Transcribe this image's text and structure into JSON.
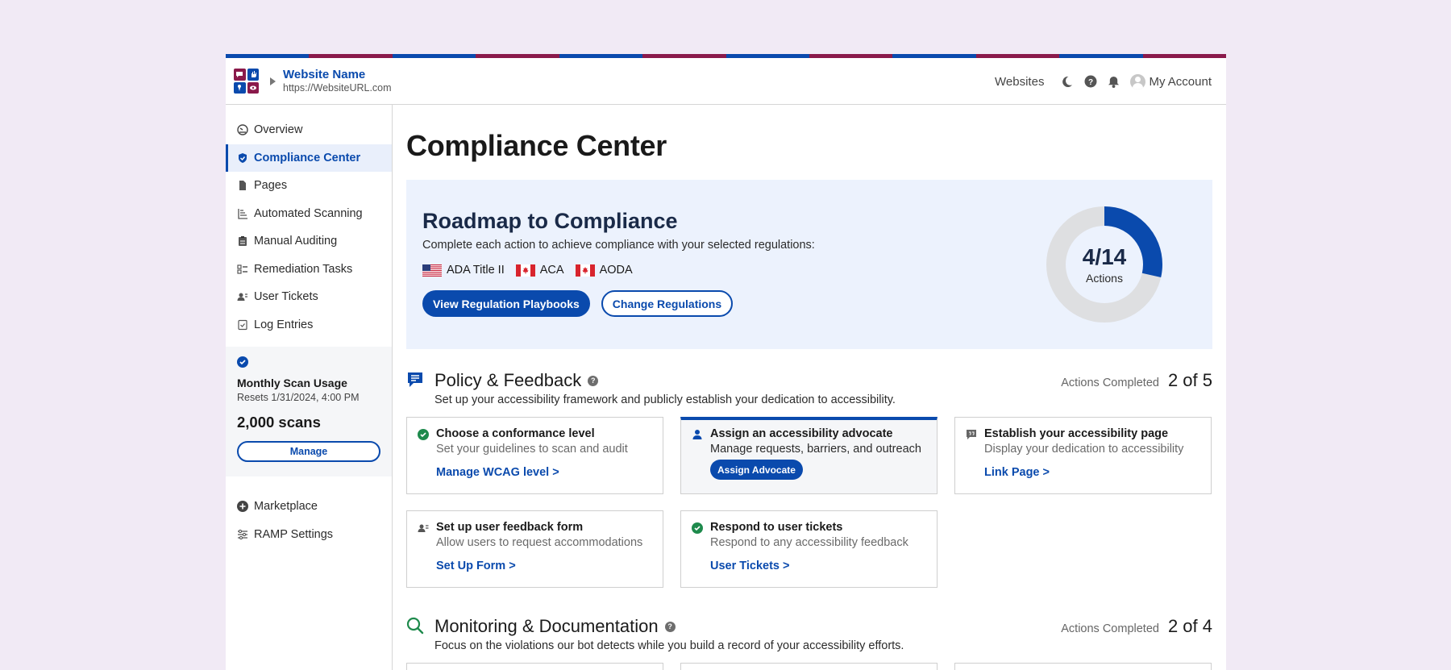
{
  "colors": {
    "brand": "#0a4aad",
    "maroon": "#8a1a4b",
    "success": "#1e8a4c"
  },
  "header": {
    "site_name": "Website Name",
    "site_url": "https://WebsiteURL.com",
    "websites": "Websites",
    "account": "My Account",
    "icons": [
      "moon-icon",
      "help-icon",
      "bell-icon"
    ]
  },
  "sidebar": {
    "items": [
      {
        "label": "Overview",
        "icon": "gauge-icon"
      },
      {
        "label": "Compliance Center",
        "icon": "shield-icon",
        "active": true
      },
      {
        "label": "Pages",
        "icon": "document-icon"
      },
      {
        "label": "Automated Scanning",
        "icon": "scan-icon"
      },
      {
        "label": "Manual Auditing",
        "icon": "clipboard-icon"
      },
      {
        "label": "Remediation Tasks",
        "icon": "checklist-icon"
      },
      {
        "label": "User Tickets",
        "icon": "user-ticket-icon"
      },
      {
        "label": "Log Entries",
        "icon": "log-icon"
      }
    ],
    "usage": {
      "title": "Monthly Scan Usage",
      "reset": "Resets 1/31/2024, 4:00 PM",
      "count": "2,000 scans",
      "manage": "Manage"
    },
    "items2": [
      {
        "label": "Marketplace",
        "icon": "plus-circle-icon"
      },
      {
        "label": "RAMP Settings",
        "icon": "sliders-icon"
      }
    ]
  },
  "main": {
    "title": "Compliance Center",
    "roadmap": {
      "title": "Roadmap to Compliance",
      "desc": "Complete each action to achieve compliance with your selected regulations:",
      "regulations": [
        {
          "label": "ADA Title II",
          "flag": "us"
        },
        {
          "label": "ACA",
          "flag": "ca"
        },
        {
          "label": "AODA",
          "flag": "ca"
        }
      ],
      "primary_btn": "View Regulation Playbooks",
      "secondary_btn": "Change Regulations",
      "progress": {
        "value": "4/14",
        "label": "Actions",
        "done": 4,
        "total": 14
      }
    },
    "policy": {
      "title": "Policy & Feedback",
      "desc": "Set up your accessibility framework and publicly establish your dedication to accessibility.",
      "completed_label": "Actions Completed",
      "completed_value": "2 of 5",
      "cards": [
        {
          "title": "Choose a conformance level",
          "desc": "Set your guidelines to scan and audit",
          "link": "Manage WCAG level >"
        },
        {
          "title": "Assign an accessibility advocate",
          "desc": "Manage requests, barriers, and outreach",
          "button": "Assign Advocate"
        },
        {
          "title": "Establish your accessibility page",
          "desc": "Display your dedication to accessibility",
          "link": "Link Page >"
        },
        {
          "title": "Set up user feedback form",
          "desc": "Allow users to request accommodations",
          "link": "Set Up Form >"
        },
        {
          "title": "Respond to user tickets",
          "desc": "Respond to any accessibility feedback",
          "link": "User Tickets >"
        }
      ]
    },
    "monitoring": {
      "title": "Monitoring & Documentation",
      "desc": "Focus on the violations our bot detects while you build a record of your accessibility efforts.",
      "completed_label": "Actions Completed",
      "completed_value": "2 of 4"
    }
  }
}
